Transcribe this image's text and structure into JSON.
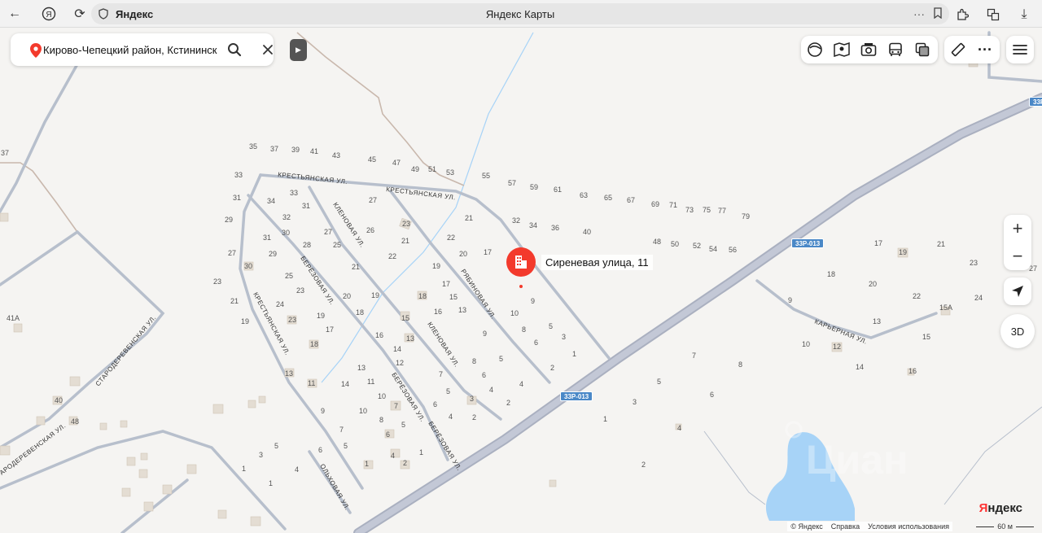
{
  "browser": {
    "address": "Яндекс",
    "title": "Яндекс Карты"
  },
  "search": {
    "value": "Кирово-Чепецкий район, Кстининск"
  },
  "marker": {
    "label": "Сиреневая улица, 11",
    "color": "#f33a2c"
  },
  "streets": {
    "krestyanskaya_1": "КРЕСТЬЯНСКАЯ УЛ.",
    "krestyanskaya_2": "КРЕСТЬЯНСКАЯ УЛ.",
    "krestyanskaya_3": "КРЕСТЬЯНСКАЯ УЛ.",
    "klenovaya_1": "КЛЕНОВАЯ УЛ.",
    "klenovaya_2": "КЛЕНОВАЯ УЛ.",
    "beryozovaya_1": "БЕРЁЗОВАЯ УЛ.",
    "beryozovaya_2": "БЕРЁЗОВАЯ УЛ.",
    "beryozovaya_3": "БЕРЁЗОВАЯ УЛ.",
    "ryabinovaya": "РЯБИНОВАЯ УЛ.",
    "olkhovaya": "ОЛЬХОВАЯ УЛ.",
    "starodereven_1": "СТАРОДЕРЕВЕНСКАЯ УЛ.",
    "starodereven_2": "АРОДЕРЕВЕНСКАЯ УЛ.",
    "karyernaya": "КАРЬЕРНАЯ УЛ."
  },
  "road_badges": [
    "33Р-013",
    "33Р-013",
    "33Р"
  ],
  "zoom": {
    "plus": "+",
    "minus": "−"
  },
  "btn_3d": "3D",
  "watermark": "Циан",
  "footer": {
    "copyright": "© Яндекс",
    "help": "Справка",
    "terms": "Условия использования"
  },
  "scale": "60 м",
  "logo": {
    "first": "Я",
    "rest": "ндекс"
  },
  "house_numbers": [
    "35",
    "37",
    "39",
    "41",
    "43",
    "45",
    "47",
    "49",
    "51",
    "53",
    "55",
    "57",
    "59",
    "61",
    "63",
    "65",
    "67",
    "69",
    "71",
    "73",
    "75",
    "77",
    "79",
    "33",
    "31",
    "29",
    "27",
    "23",
    "21",
    "19",
    "37",
    "34",
    "33",
    "32",
    "31",
    "30",
    "28",
    "29",
    "27",
    "26",
    "25",
    "24",
    "23",
    "22",
    "21",
    "20",
    "19",
    "18",
    "17",
    "16",
    "15",
    "14",
    "13",
    "12",
    "11",
    "10",
    "9",
    "8",
    "7",
    "6",
    "5",
    "4",
    "3",
    "2",
    "1",
    "32",
    "34",
    "36",
    "40",
    "48",
    "50",
    "52",
    "54",
    "56",
    "17",
    "19",
    "21",
    "23",
    "24",
    "18",
    "20",
    "22",
    "13",
    "15",
    "14",
    "16",
    "12",
    "10",
    "9",
    "7",
    "8",
    "5",
    "6",
    "4",
    "3",
    "2",
    "1",
    "41А",
    "40",
    "48",
    "15А",
    "27"
  ]
}
